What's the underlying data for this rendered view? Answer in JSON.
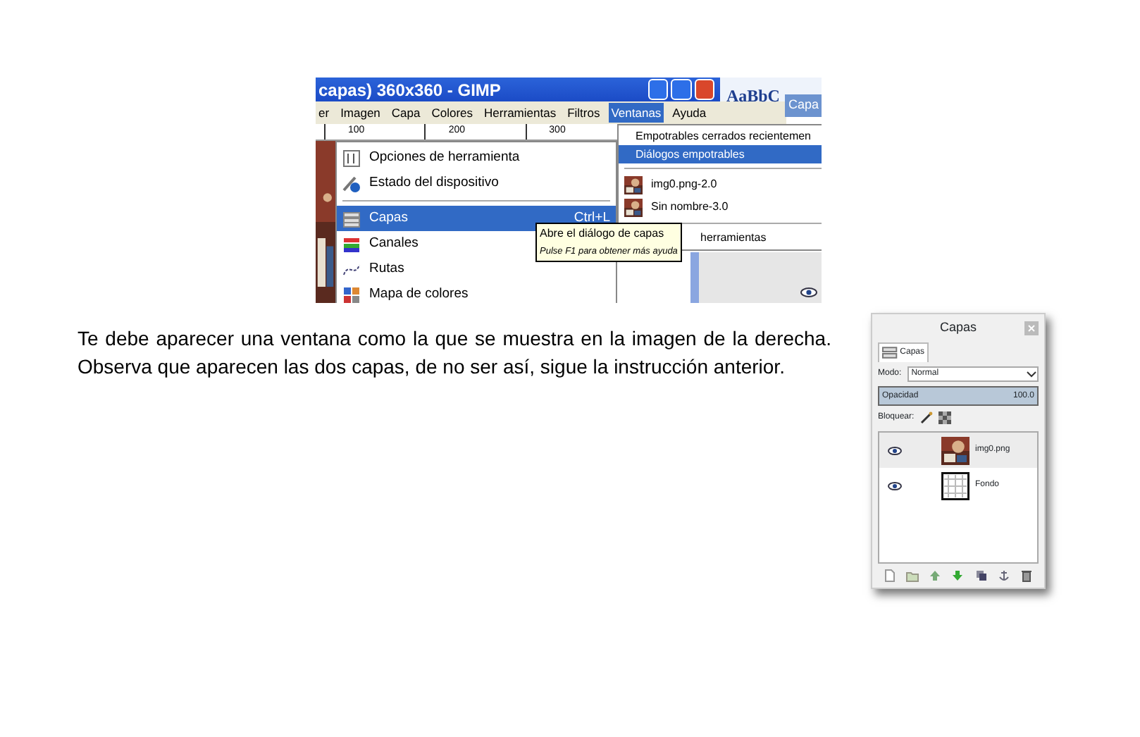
{
  "gimp_window": {
    "title": "capas) 360x360 - GIMP",
    "menu_bar": [
      {
        "label": "er",
        "selected": false
      },
      {
        "label": "Imagen",
        "selected": false
      },
      {
        "label": "Capa",
        "selected": false
      },
      {
        "label": "Colores",
        "selected": false
      },
      {
        "label": "Herramientas",
        "selected": false
      },
      {
        "label": "Filtros",
        "selected": false
      },
      {
        "label": "Ventanas",
        "selected": true
      },
      {
        "label": "Ayuda",
        "selected": false
      }
    ],
    "ruler_labels": [
      "100",
      "200",
      "300"
    ],
    "word_preview": {
      "style_sample": "AaBbC",
      "tab": "Capa"
    },
    "dock_menu": [
      {
        "kind": "item",
        "label": "Opciones de herramienta",
        "selected": false
      },
      {
        "kind": "item",
        "label": "Estado del dispositivo",
        "selected": false
      },
      {
        "kind": "separator"
      },
      {
        "kind": "item",
        "label": "Capas",
        "shortcut": "Ctrl+L",
        "selected": true
      },
      {
        "kind": "item",
        "label": "Canales",
        "selected": false
      },
      {
        "kind": "item",
        "label": "Rutas",
        "selected": false
      },
      {
        "kind": "item",
        "label": "Mapa de colores",
        "selected": false
      }
    ],
    "windows_menu": [
      {
        "kind": "item",
        "label": "Empotrables cerrados recientemen",
        "selected": false
      },
      {
        "kind": "item",
        "label": "Diálogos empotrables",
        "selected": true
      },
      {
        "kind": "separator"
      },
      {
        "label": "img0.png-2.0",
        "selected": false
      },
      {
        "label": "Sin nombre-3.0",
        "selected": false
      },
      {
        "kind": "separator"
      },
      {
        "kind": "covered",
        "label": "herramientas",
        "selected": false
      }
    ],
    "tooltip": {
      "title": "Abre el diálogo de capas",
      "hint": "Pulse F1 para obtener más ayuda"
    }
  },
  "paragraph": "Te debe aparecer una ventana como la que se muestra en la imagen de la derecha. Observa que aparecen las dos capas, de no ser así, sigue la instrucción anterior.",
  "layers_dialog": {
    "title": "Capas",
    "tab": "Capas",
    "mode_label": "Modo:",
    "mode": "Normal",
    "opacity": {
      "label": "Opacidad",
      "value": "100.0",
      "level": 1
    },
    "lock_label": "Bloquear:",
    "layers": [
      {
        "name": "img0.png",
        "selected": true
      },
      {
        "name": "Fondo",
        "selected": false
      }
    ]
  }
}
